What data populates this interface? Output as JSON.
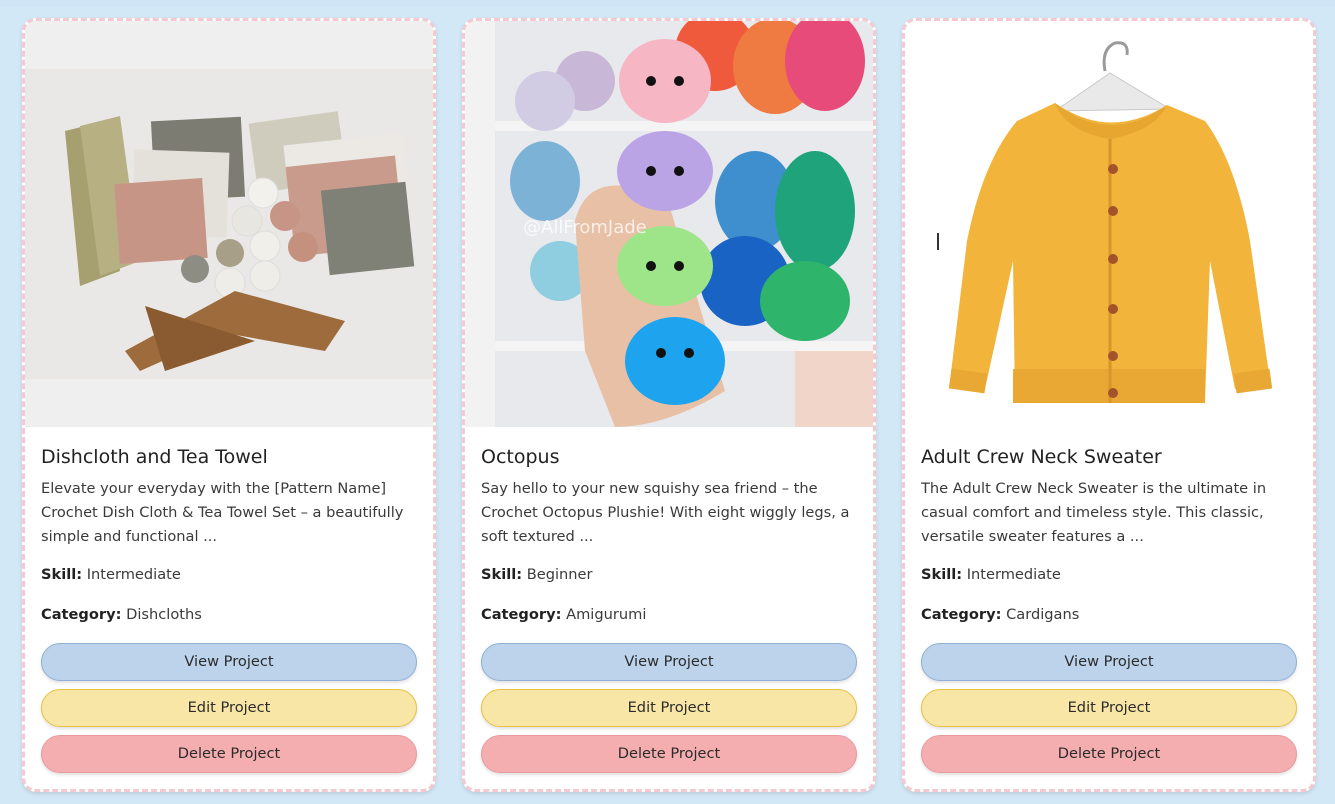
{
  "cards": [
    {
      "title": "Dishcloth and Tea Towel",
      "description": "Elevate your everyday with the [Pattern Name] Crochet Dish Cloth & Tea Towel Set – a beautifully simple and functional ...",
      "skill_label": "Skill:",
      "skill_value": "Intermediate",
      "category_label": "Category:",
      "category_value": "Dishcloths",
      "view_label": "View Project",
      "edit_label": "Edit Project",
      "delete_label": "Delete Project"
    },
    {
      "title": "Octopus",
      "description": "Say hello to your new squishy sea friend – the Crochet Octopus Plushie! With eight wiggly legs, a soft textured ...",
      "image_watermark": "@AllFromJade",
      "skill_label": "Skill:",
      "skill_value": "Beginner",
      "category_label": "Category:",
      "category_value": "Amigurumi",
      "view_label": "View Project",
      "edit_label": "Edit Project",
      "delete_label": "Delete Project"
    },
    {
      "title": "Adult Crew Neck Sweater",
      "description": "The Adult Crew Neck Sweater is the ultimate in casual comfort and timeless style. This classic, versatile sweater features a ...",
      "skill_label": "Skill:",
      "skill_value": "Intermediate",
      "category_label": "Category:",
      "category_value": "Cardigans",
      "view_label": "View Project",
      "edit_label": "Edit Project",
      "delete_label": "Delete Project"
    }
  ],
  "colors": {
    "page_background": "#d3e8f7",
    "card_border": "#f4c9cf",
    "view_button": "#bcd3eb",
    "edit_button": "#f8e6a6",
    "delete_button": "#f5aeb0"
  }
}
